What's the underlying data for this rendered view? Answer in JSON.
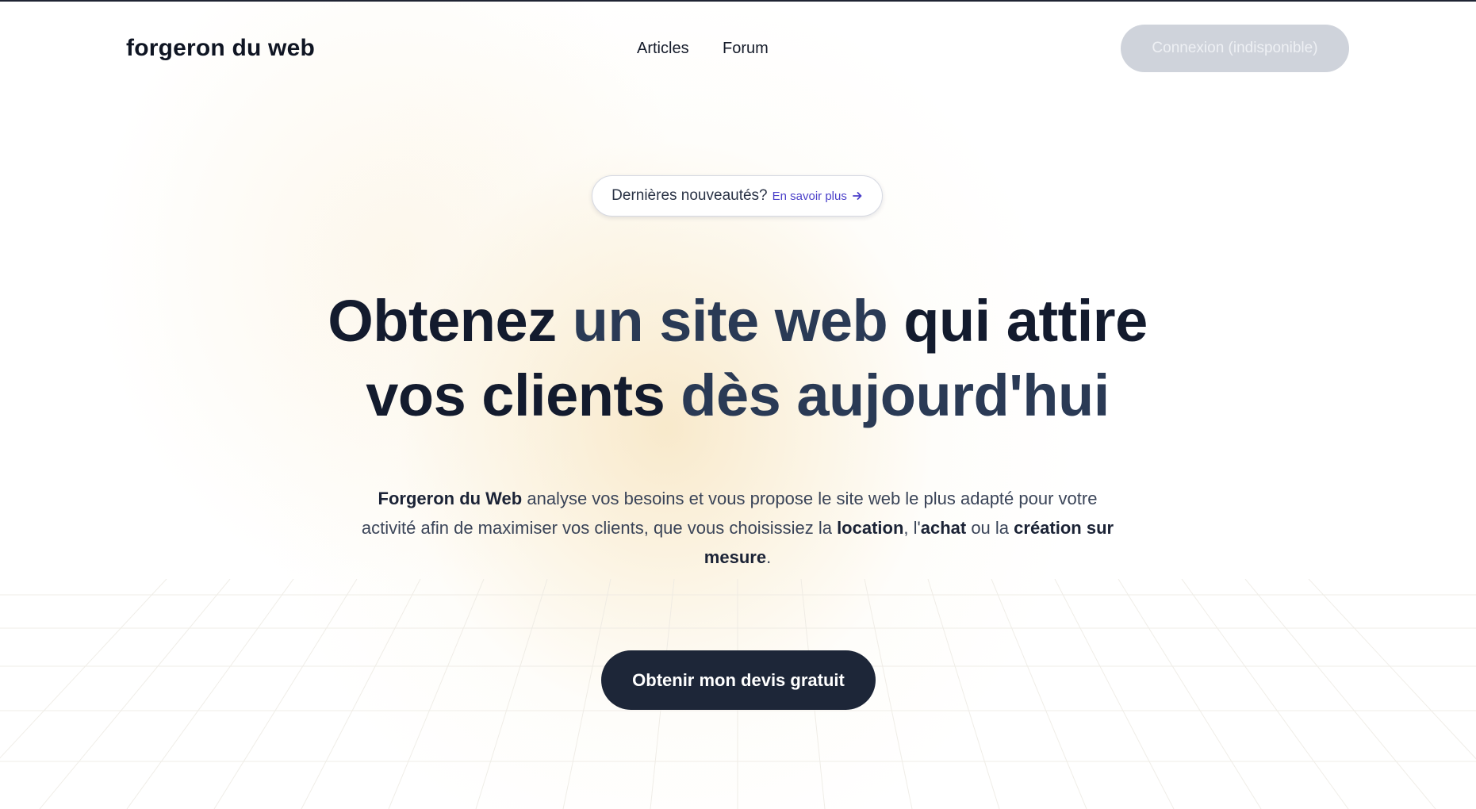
{
  "header": {
    "logo": "forgeron du web",
    "nav": [
      {
        "label": "Articles"
      },
      {
        "label": "Forum"
      }
    ],
    "login_label": "Connexion (indisponible)"
  },
  "announcement": {
    "text": "Dernières nouveautés?",
    "link_label": "En savoir plus",
    "link_icon": "arrow-right-icon"
  },
  "hero": {
    "title": {
      "w1": "Obtenez",
      "w2": "un",
      "w3": "site",
      "w4": "web",
      "w5": "qui",
      "w6": "attire",
      "w7": "vos",
      "w8": "clients",
      "w9": "dès",
      "w10": "aujourd'hui"
    },
    "description": {
      "brand": "Forgeron du Web",
      "part1": " analyse vos besoins et vous propose le site web le plus adapté pour votre activité afin de maximiser vos clients, que vous choisissiez la ",
      "location": "location",
      "part2": ", l'",
      "achat": "achat",
      "part3": " ou la ",
      "creation": "création sur mesure",
      "part4": "."
    },
    "cta_label": "Obtenir mon devis gratuit"
  },
  "colors": {
    "primary": "#1d2638",
    "accent_link": "#4a3fc9",
    "login_disabled": "#cfd3db",
    "glow": "#f6e2ba"
  }
}
